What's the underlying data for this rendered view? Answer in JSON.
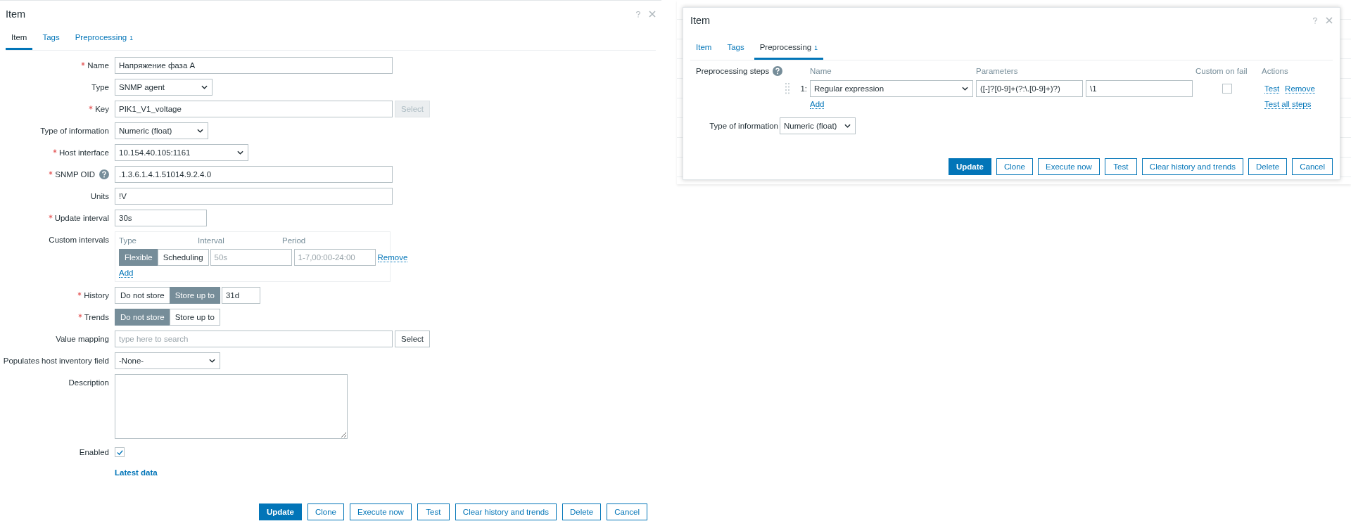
{
  "item_dialog": {
    "title": "Item",
    "tabs": [
      {
        "label": "Item",
        "selected": true
      },
      {
        "label": "Tags",
        "selected": false
      },
      {
        "label": "Preprocessing",
        "count": "1",
        "selected": false
      }
    ],
    "rows": [
      {
        "kind": "text",
        "label": "Name",
        "required": true,
        "value": "Напряжение фаза А"
      },
      {
        "kind": "select",
        "label": "Type",
        "required": false,
        "value": "SNMP agent"
      },
      {
        "kind": "text_button",
        "label": "Key",
        "required": true,
        "value": "PIK1_V1_voltage",
        "button": {
          "label": "Select",
          "disabled": true
        }
      },
      {
        "kind": "select",
        "label": "Type of information",
        "required": false,
        "value": "Numeric (float)"
      },
      {
        "kind": "select",
        "label": "Host interface",
        "required": true,
        "value": "10.154.40.105:1161"
      },
      {
        "kind": "text",
        "label": "SNMP OID",
        "required": true,
        "help": true,
        "value": ".1.3.6.1.4.1.51014.9.2.4.0"
      },
      {
        "kind": "text",
        "label": "Units",
        "required": false,
        "value": "!V"
      },
      {
        "kind": "text",
        "label": "Update interval",
        "required": true,
        "value": "30s"
      },
      {
        "kind": "intervals",
        "label": "Custom intervals",
        "required": false,
        "columns": [
          "Type",
          "Interval",
          "Period"
        ],
        "entries": [
          {
            "options": [
              {
                "label": "Flexible",
                "selected": true
              },
              {
                "label": "Scheduling",
                "selected": false
              }
            ],
            "interval_placeholder": "50s",
            "period_placeholder": "1-7,00:00-24:00",
            "remove": "Remove"
          }
        ],
        "add": "Add"
      },
      {
        "kind": "segmented",
        "label": "History",
        "required": true,
        "options": [
          {
            "label": "Do not store",
            "selected": false
          },
          {
            "label": "Store up to",
            "selected": true
          }
        ],
        "value": "31d"
      },
      {
        "kind": "segmented",
        "label": "Trends",
        "required": true,
        "options": [
          {
            "label": "Do not store",
            "selected": true
          },
          {
            "label": "Store up to",
            "selected": false
          }
        ]
      },
      {
        "kind": "text_button",
        "label": "Value mapping",
        "required": false,
        "placeholder": "type here to search",
        "button": {
          "label": "Select",
          "disabled": false
        }
      },
      {
        "kind": "select",
        "label": "Populates host inventory field",
        "required": false,
        "value": "-None-"
      },
      {
        "kind": "textarea",
        "label": "Description",
        "required": false
      },
      {
        "kind": "checkbox",
        "label": "Enabled",
        "required": false,
        "checked": true
      },
      {
        "kind": "link",
        "label_link": "Latest data"
      }
    ],
    "buttons": [
      {
        "label": "Update",
        "primary": true
      },
      {
        "label": "Clone",
        "primary": false
      },
      {
        "label": "Execute now",
        "primary": false
      },
      {
        "label": "Test",
        "primary": false
      },
      {
        "label": "Clear history and trends",
        "primary": false
      },
      {
        "label": "Delete",
        "primary": false
      },
      {
        "label": "Cancel",
        "primary": false
      }
    ]
  },
  "preprocessing_dialog": {
    "title": "Item",
    "tabs": [
      {
        "label": "Item",
        "selected": false
      },
      {
        "label": "Tags",
        "selected": false
      },
      {
        "label": "Preprocessing",
        "count": "1",
        "selected": true
      }
    ],
    "steps_label": "Preprocessing steps",
    "columns": [
      "Name",
      "Parameters",
      "Custom on fail",
      "Actions"
    ],
    "steps": [
      {
        "number": "1:",
        "name": "Regular expression",
        "params": [
          "([-]?[0-9]+(?:\\.[0-9]+)?)",
          "\\1"
        ],
        "custom_on_fail": false,
        "actions": [
          "Test",
          "Remove"
        ]
      }
    ],
    "add": "Add",
    "test_all": "Test all steps",
    "type_of_information": {
      "label": "Type of information",
      "value": "Numeric (float)"
    },
    "buttons": [
      {
        "label": "Update",
        "primary": true
      },
      {
        "label": "Clone",
        "primary": false
      },
      {
        "label": "Execute now",
        "primary": false
      },
      {
        "label": "Test",
        "primary": false
      },
      {
        "label": "Clear history and trends",
        "primary": false
      },
      {
        "label": "Delete",
        "primary": false
      },
      {
        "label": "Cancel",
        "primary": false
      }
    ]
  }
}
